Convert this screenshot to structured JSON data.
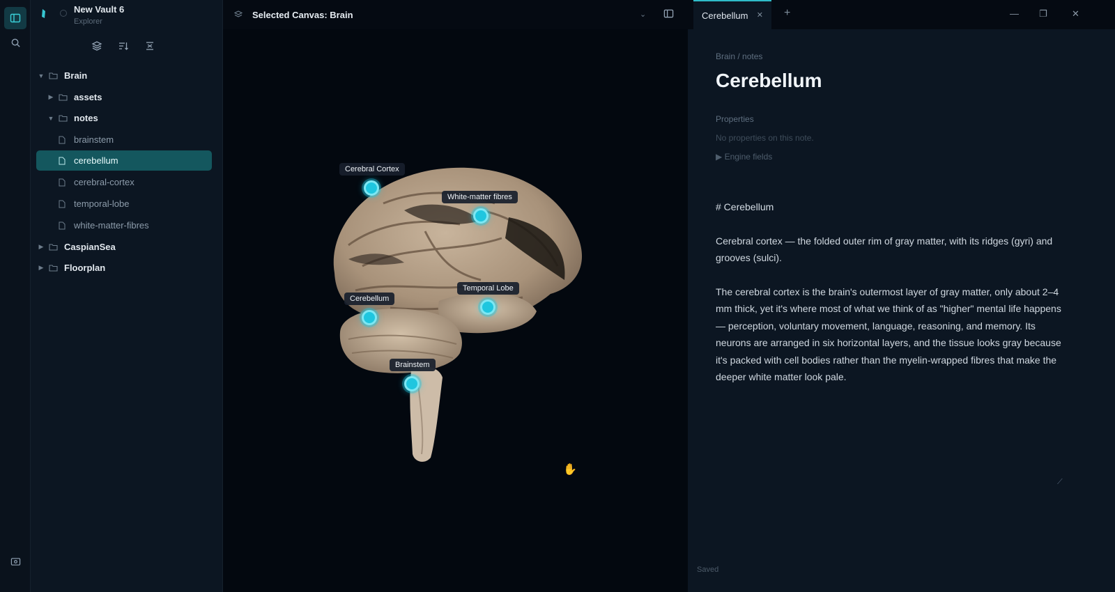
{
  "sidebar": {
    "vault_name": "New Vault 6",
    "vault_subtitle": "Explorer",
    "tree": [
      {
        "label": "Brain",
        "kind": "folder",
        "expanded": true
      },
      {
        "label": "assets",
        "kind": "folder",
        "expanded": false
      },
      {
        "label": "notes",
        "kind": "folder",
        "expanded": true
      },
      {
        "label": "brainstem",
        "kind": "file"
      },
      {
        "label": "cerebellum",
        "kind": "file",
        "selected": true
      },
      {
        "label": "cerebral-cortex",
        "kind": "file"
      },
      {
        "label": "temporal-lobe",
        "kind": "file"
      },
      {
        "label": "white-matter-fibres",
        "kind": "file"
      },
      {
        "label": "CaspianSea",
        "kind": "folder",
        "expanded": false
      },
      {
        "label": "Floorplan",
        "kind": "folder",
        "expanded": false
      }
    ]
  },
  "canvas": {
    "title": "Selected Canvas: Brain",
    "hotspots": [
      {
        "label": "Cerebral Cortex"
      },
      {
        "label": "White-matter fibres"
      },
      {
        "label": "Temporal Lobe"
      },
      {
        "label": "Cerebellum"
      },
      {
        "label": "Brainstem"
      }
    ]
  },
  "tabs": {
    "active_label": "Cerebellum"
  },
  "note": {
    "breadcrumb": "Brain / notes",
    "title": "Cerebellum",
    "properties_label": "Properties",
    "properties_empty": "No properties on this note.",
    "engine_fields": "Engine fields",
    "md_heading": "# Cerebellum",
    "paragraph_1": "Cerebral cortex — the folded outer rim of gray matter, with its ridges (gyri) and grooves (sulci).",
    "paragraph_2": "The cerebral cortex is the brain's outermost layer of gray matter, only about 2–4 mm thick, yet it's where most of what we think of as \"higher\" mental life happens — perception, voluntary movement, language, reasoning, and memory. Its neurons are arranged in six horizontal layers, and the tissue looks gray because it's packed with cell bodies rather than the myelin-wrapped fibres that make the deeper white matter look pale.",
    "status": "Saved"
  },
  "colors": {
    "accent": "#2fbcc9",
    "selection": "#14575e",
    "hotspot": "#1fc6df"
  },
  "icons": {
    "ribbon": [
      "sidebar-toggle-icon",
      "search-icon",
      "vault-settings-icon"
    ],
    "sidebar_tools": [
      "layers-icon",
      "sort-icon",
      "collapse-all-icon"
    ]
  }
}
